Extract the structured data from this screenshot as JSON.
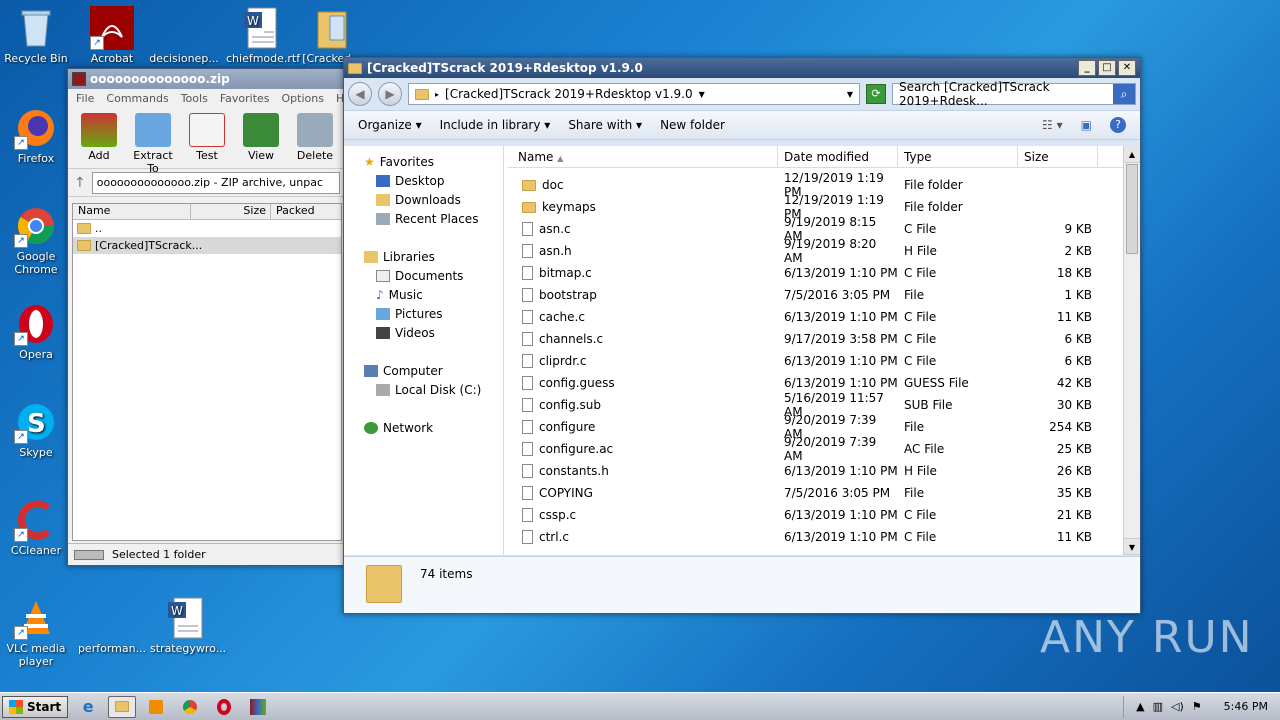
{
  "desktop": {
    "icons": [
      {
        "label": "Recycle Bin"
      },
      {
        "label": "Acrobat"
      },
      {
        "label": "decisionep..."
      },
      {
        "label": "chiefmode.rtf"
      },
      {
        "label": "[Cracked..."
      },
      {
        "label": "Firefox"
      },
      {
        "label": "Google Chrome"
      },
      {
        "label": "Opera"
      },
      {
        "label": "Skype"
      },
      {
        "label": "CCleaner"
      },
      {
        "label": "VLC media player"
      },
      {
        "label": "performan..."
      },
      {
        "label": "strategywro..."
      }
    ],
    "watermark": "ANY RUN"
  },
  "winrar": {
    "title": "oooooooooooooo.zip",
    "menu": [
      "File",
      "Commands",
      "Tools",
      "Favorites",
      "Options",
      "Help"
    ],
    "toolbar": [
      "Add",
      "Extract To",
      "Test",
      "View",
      "Delete"
    ],
    "path": "oooooooooooooo.zip - ZIP archive, unpac",
    "columns": [
      "Name",
      "Size",
      "Packed"
    ],
    "rows": [
      "..",
      "[Cracked]TScrack..."
    ],
    "status": "Selected 1 folder"
  },
  "explorer": {
    "title": "[Cracked]TScrack 2019+Rdesktop v1.9.0",
    "address": "[Cracked]TScrack 2019+Rdesktop v1.9.0",
    "search_placeholder": "Search [Cracked]TScrack 2019+Rdesk...",
    "commands": [
      "Organize",
      "Include in library",
      "Share with",
      "New folder"
    ],
    "nav": {
      "favorites": "Favorites",
      "fav_items": [
        "Desktop",
        "Downloads",
        "Recent Places"
      ],
      "libraries": "Libraries",
      "lib_items": [
        "Documents",
        "Music",
        "Pictures",
        "Videos"
      ],
      "computer": "Computer",
      "comp_items": [
        "Local Disk (C:)"
      ],
      "network": "Network"
    },
    "columns": [
      "Name",
      "Date modified",
      "Type",
      "Size"
    ],
    "files": [
      {
        "name": "doc",
        "date": "12/19/2019 1:19 PM",
        "type": "File folder",
        "size": "",
        "folder": true
      },
      {
        "name": "keymaps",
        "date": "12/19/2019 1:19 PM",
        "type": "File folder",
        "size": "",
        "folder": true
      },
      {
        "name": "asn.c",
        "date": "9/19/2019 8:15 AM",
        "type": "C File",
        "size": "9 KB"
      },
      {
        "name": "asn.h",
        "date": "9/19/2019 8:20 AM",
        "type": "H File",
        "size": "2 KB"
      },
      {
        "name": "bitmap.c",
        "date": "6/13/2019 1:10 PM",
        "type": "C File",
        "size": "18 KB"
      },
      {
        "name": "bootstrap",
        "date": "7/5/2016 3:05 PM",
        "type": "File",
        "size": "1 KB"
      },
      {
        "name": "cache.c",
        "date": "6/13/2019 1:10 PM",
        "type": "C File",
        "size": "11 KB"
      },
      {
        "name": "channels.c",
        "date": "9/17/2019 3:58 PM",
        "type": "C File",
        "size": "6 KB"
      },
      {
        "name": "cliprdr.c",
        "date": "6/13/2019 1:10 PM",
        "type": "C File",
        "size": "6 KB"
      },
      {
        "name": "config.guess",
        "date": "6/13/2019 1:10 PM",
        "type": "GUESS File",
        "size": "42 KB"
      },
      {
        "name": "config.sub",
        "date": "5/16/2019 11:57 AM",
        "type": "SUB File",
        "size": "30 KB"
      },
      {
        "name": "configure",
        "date": "9/20/2019 7:39 AM",
        "type": "File",
        "size": "254 KB"
      },
      {
        "name": "configure.ac",
        "date": "9/20/2019 7:39 AM",
        "type": "AC File",
        "size": "25 KB"
      },
      {
        "name": "constants.h",
        "date": "6/13/2019 1:10 PM",
        "type": "H File",
        "size": "26 KB"
      },
      {
        "name": "COPYING",
        "date": "7/5/2016 3:05 PM",
        "type": "File",
        "size": "35 KB"
      },
      {
        "name": "cssp.c",
        "date": "6/13/2019 1:10 PM",
        "type": "C File",
        "size": "21 KB"
      },
      {
        "name": "ctrl.c",
        "date": "6/13/2019 1:10 PM",
        "type": "C File",
        "size": "11 KB"
      }
    ],
    "item_count": "74 items"
  },
  "taskbar": {
    "start": "Start",
    "clock": "5:46 PM"
  }
}
